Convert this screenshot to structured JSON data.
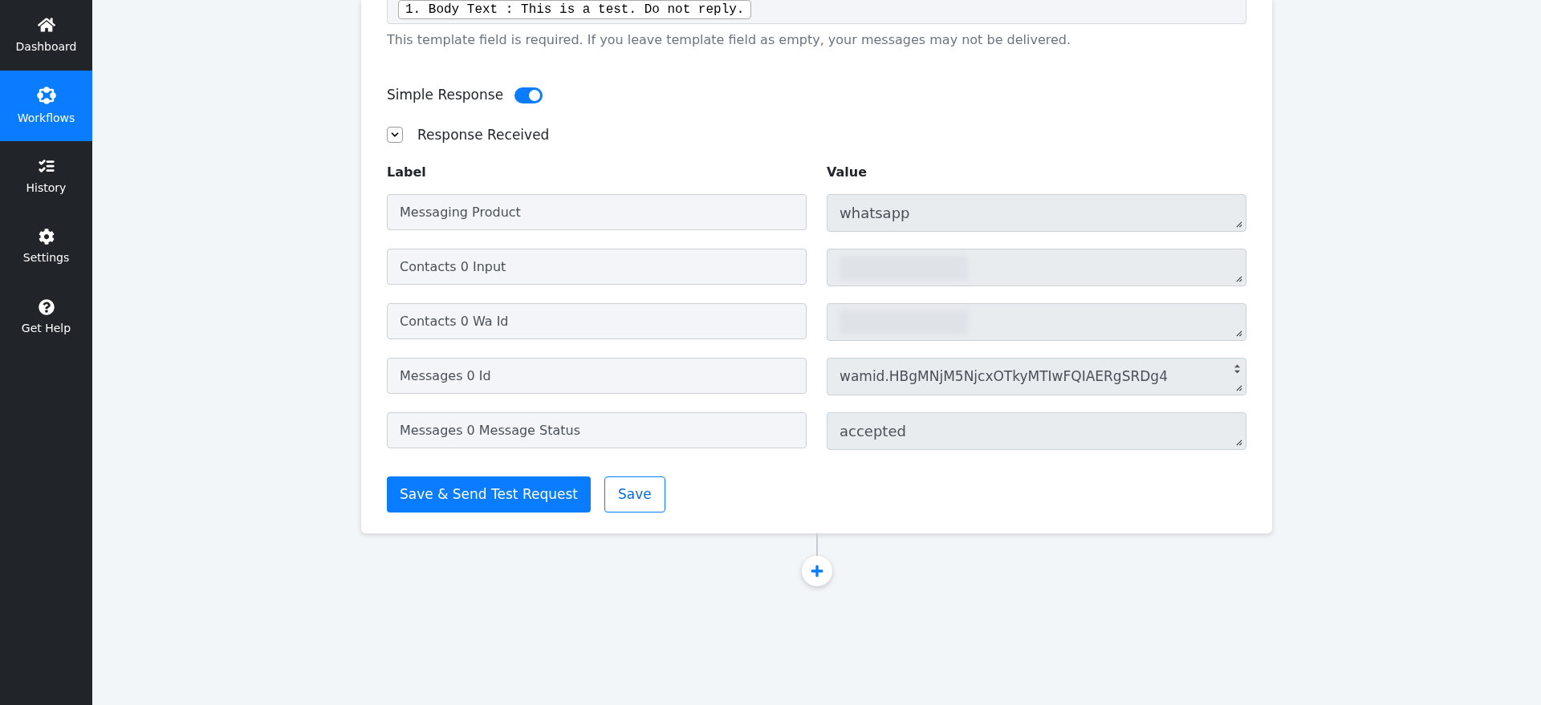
{
  "sidebar": {
    "items": [
      {
        "label": "Dashboard",
        "selected": false
      },
      {
        "label": "Workflows",
        "selected": true
      },
      {
        "label": "History",
        "selected": false
      },
      {
        "label": "Settings",
        "selected": false
      },
      {
        "label": "Get Help",
        "selected": false
      }
    ]
  },
  "template": {
    "chip": "1. Body Text : This is a test. Do not reply.",
    "help": "This template field is required. If you leave template field as empty, your messages may not be delivered."
  },
  "simple_response": {
    "label": "Simple Response",
    "on": true
  },
  "response_received": {
    "label": "Response Received",
    "expanded": true
  },
  "table": {
    "columns": [
      "Label",
      "Value"
    ],
    "rows": [
      {
        "label": "Messaging Product",
        "kind": "text",
        "value": "whatsapp"
      },
      {
        "label": "Contacts 0 Input",
        "kind": "redacted"
      },
      {
        "label": "Contacts 0 Wa Id",
        "kind": "redacted"
      },
      {
        "label": "Messages 0 Id",
        "kind": "overflow",
        "value": "wamid.HBgMNjM5NjcxOTkyMTIwFQIAERgSRDg4"
      },
      {
        "label": "Messages 0 Message Status",
        "kind": "text",
        "value": "accepted"
      }
    ]
  },
  "buttons": {
    "primary": "Save & Send Test Request",
    "secondary": "Save"
  }
}
